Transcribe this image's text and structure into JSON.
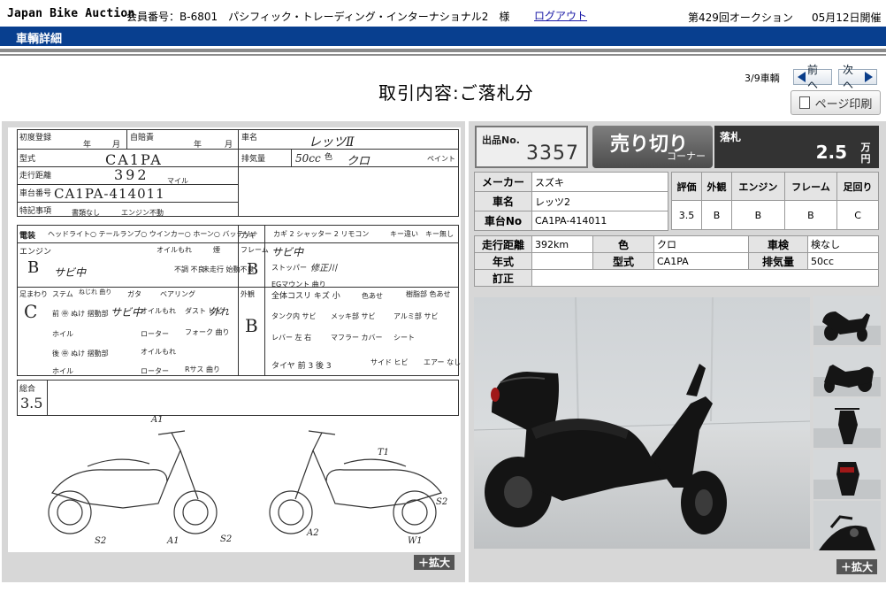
{
  "header": {
    "logo": "Japan Bike Auction",
    "member": "会員番号：B-6801　パシフィック・トレーディング・インターナショナル2　様",
    "logout": "ログアウト",
    "auction_no": "第429回オークション",
    "auction_date": "05月12日開催"
  },
  "nav": {
    "section": "車輌詳細"
  },
  "paging": {
    "counter": "3/9車輌",
    "prev": "前へ",
    "next": "次へ",
    "print": "ページ印刷"
  },
  "page_title": "取引内容:ご落札分",
  "sheet": {
    "reg_label": "初度登録",
    "year_label": "年",
    "month_label": "月",
    "insurance_label": "自賠責",
    "name_label": "車名",
    "name_value": "レッツⅡ",
    "type_label": "型式",
    "type_value": "CA1PA",
    "cc_label": "排気量",
    "cc_value": "50cc",
    "color_label": "色",
    "color_value": "クロ",
    "paint_label": "ペイント",
    "mileage_label": "走行距離",
    "mileage_value": "392",
    "mile_label": "マイル",
    "frame_label": "車台番号",
    "frame_value": "CA1PA-414011",
    "notes_label": "特記事項",
    "notes_docs": "書類なし",
    "notes_engine": "エンジン不動",
    "elec_label": "電装",
    "elec_items": "ヘッドライト○ テールランプ○ ウインカー○ ホーン○ バッテリー",
    "key_label": "カギ",
    "key_items": "カギ 2 シャッター 2 リモコン",
    "key_diff": "キー違い",
    "key_none": "キー無し",
    "engine_label": "エンジン",
    "engine_grade": "B",
    "engine_note": "サビ中",
    "oil_leak": "オイルもれ",
    "smoke": "煙",
    "no_start": "不調 不良",
    "no_run": "未走行 始動不良",
    "frame_grade_label": "フレーム",
    "frame_grade": "B",
    "frame_note": "サビ中",
    "stopper": "ストッパー",
    "stopper_note": "修正川",
    "eg_mount": "EGマウント 曲り",
    "suspension_label": "足まわり",
    "suspension_grade": "C",
    "stem": "ステム",
    "screw": "ねじれ 曲り",
    "play": "ガタ",
    "bearing": "ベアリング",
    "front": "前 ㊥ ぬけ 摺動部",
    "front_note": "サビ中",
    "oil1": "オイルもれ",
    "dust": "ダスト ヒビ",
    "dust_note": "外れ",
    "wheel": "ホイル",
    "rotor": "ローター",
    "fork": "フォーク 曲り",
    "rear": "後 ㊥ ぬけ 摺動部",
    "oil2": "オイルもれ",
    "wheel2": "ホイル",
    "rotor2": "ローター",
    "rsus": "Rサス 曲り",
    "exterior_label": "外観",
    "exterior_grade": "B",
    "exterior_note": "全体コスリ キズ 小",
    "fade": "色あせ",
    "resin": "樹脂部 色あせ",
    "tank": "タンク内 サビ",
    "plating": "メッキ部 サビ",
    "alu": "アルミ部 サビ",
    "lever": "レバー 左 右",
    "muffler": "マフラー カバー",
    "seat": "シート",
    "tire": "タイヤ 前 3 後 3",
    "side": "サイド ヒビ",
    "air": "エアー なし",
    "total_label": "総合",
    "total_value": "3.5",
    "marks": [
      "A1",
      "S2",
      "A1",
      "S2",
      "T1",
      "A2",
      "S2",
      "W1"
    ]
  },
  "lot": {
    "label": "出品No.",
    "number": "3357"
  },
  "sale": {
    "main": "売り切り",
    "sub": "コーナー"
  },
  "bid": {
    "label": "落札",
    "value": "2.5",
    "unit": "万円"
  },
  "spec": {
    "maker_label": "メーカー",
    "maker": "スズキ",
    "model_label": "車名",
    "model": "レッツ2",
    "frame_label": "車台No",
    "frame": "CA1PA-414011",
    "grades": [
      {
        "label": "評価",
        "value": "3.5"
      },
      {
        "label": "外観",
        "value": "B"
      },
      {
        "label": "エンジン",
        "value": "B"
      },
      {
        "label": "フレーム",
        "value": "B"
      },
      {
        "label": "足回り",
        "value": "C"
      }
    ],
    "mileage_label": "走行距離",
    "mileage": "392km",
    "color_label": "色",
    "color": "クロ",
    "inspection_label": "車検",
    "inspection": "検なし",
    "year_label": "年式",
    "year": "",
    "type_label": "型式",
    "type": "CA1PA",
    "cc_label": "排気量",
    "cc": "50cc",
    "correction_label": "訂正",
    "correction": ""
  },
  "zoom_label": "＋拡大",
  "colors": {
    "navbar": "#083f8f",
    "panel": "#d7d7d7",
    "bid_bg": "#333333"
  }
}
